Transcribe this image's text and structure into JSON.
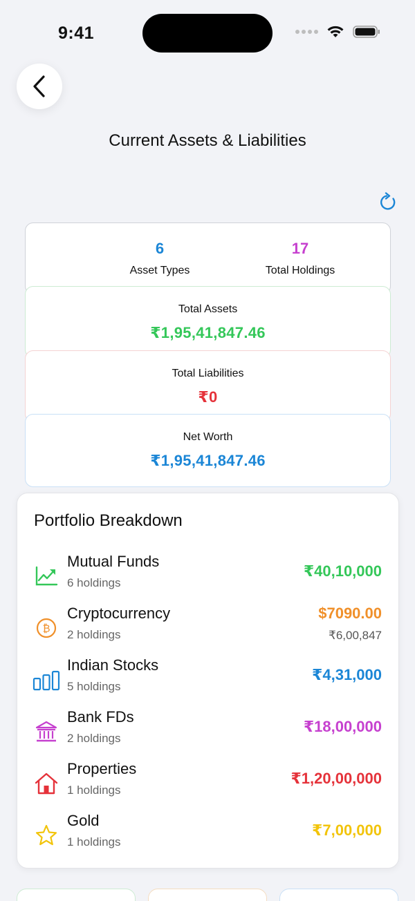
{
  "status_bar": {
    "time": "9:41"
  },
  "header": {
    "title": "Current Assets & Liabilities"
  },
  "summary": {
    "asset_types_count": "6",
    "asset_types_label": "Asset Types",
    "total_holdings_count": "17",
    "total_holdings_label": "Total Holdings",
    "total_assets_label": "Total Assets",
    "total_assets_value": "₹1,95,41,847.46",
    "total_liabilities_label": "Total Liabilities",
    "total_liabilities_value": "₹0",
    "net_worth_label": "Net Worth",
    "net_worth_value": "₹1,95,41,847.46"
  },
  "portfolio": {
    "title": "Portfolio Breakdown",
    "items": [
      {
        "name": "Mutual Funds",
        "holdings": "6 holdings",
        "amount": "₹40,10,000",
        "color": "#34c759",
        "icon": "trend-chart-icon"
      },
      {
        "name": "Cryptocurrency",
        "holdings": "2 holdings",
        "amount": "$7090.00",
        "secondary": "₹6,00,847",
        "color": "#f0902a",
        "icon": "bitcoin-icon"
      },
      {
        "name": "Indian Stocks",
        "holdings": "5 holdings",
        "amount": "₹4,31,000",
        "color": "#1b86d6",
        "icon": "bar-chart-icon"
      },
      {
        "name": "Bank FDs",
        "holdings": "2 holdings",
        "amount": "₹18,00,000",
        "color": "#c640cf",
        "icon": "bank-icon"
      },
      {
        "name": "Properties",
        "holdings": "1 holdings",
        "amount": "₹1,20,00,000",
        "color": "#e5323a",
        "icon": "house-icon"
      },
      {
        "name": "Gold",
        "holdings": "1 holdings",
        "amount": "₹7,00,000",
        "color": "#f2c40a",
        "icon": "star-icon"
      }
    ]
  },
  "colors": {
    "assets": "#34c759",
    "liabilities": "#e5323a",
    "net_worth": "#1b86d6",
    "holdings": "#c640cf"
  }
}
